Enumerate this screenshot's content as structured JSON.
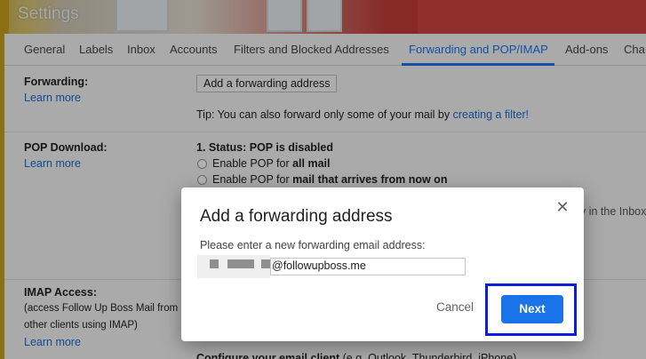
{
  "app": {
    "title": "Settings"
  },
  "tabs": [
    {
      "label": "General"
    },
    {
      "label": "Labels"
    },
    {
      "label": "Inbox"
    },
    {
      "label": "Accounts"
    },
    {
      "label": "Filters and Blocked Addresses"
    },
    {
      "label": "Forwarding and POP/IMAP",
      "active": true
    },
    {
      "label": "Add-ons"
    },
    {
      "label": "Cha"
    }
  ],
  "forwarding": {
    "label": "Forwarding:",
    "learn_more": "Learn more",
    "add_button": "Add a forwarding address",
    "tip_prefix": "Tip: You can also forward only some of your mail by ",
    "tip_link": "creating a filter!"
  },
  "pop": {
    "label": "POP Download:",
    "learn_more": "Learn more",
    "status": "1. Status: POP is disabled",
    "option1_prefix": "Enable POP for ",
    "option1_bold": "all mail",
    "option2_prefix": "Enable POP for ",
    "option2_bold": "mail that arrives from now on",
    "partial_right": "y in the Inbox"
  },
  "imap": {
    "label": "IMAP Access:",
    "desc_line1": "(access Follow Up Boss Mail from",
    "desc_line2": "other clients using IMAP)",
    "learn_more": "Learn more",
    "configure_prefix": "Configure your email client",
    "configure_rest": " (e.g. Outlook, Thunderbird, iPhone)"
  },
  "dialog": {
    "title": "Add a forwarding address",
    "prompt": "Please enter a new forwarding email address:",
    "email_value": "@followupboss.me",
    "cancel_label": "Cancel",
    "next_label": "Next",
    "close_icon": "close-icon"
  },
  "colors": {
    "accent": "#1a73e8",
    "highlight_box": "#0a20d6",
    "link": "#1a6bd1"
  }
}
